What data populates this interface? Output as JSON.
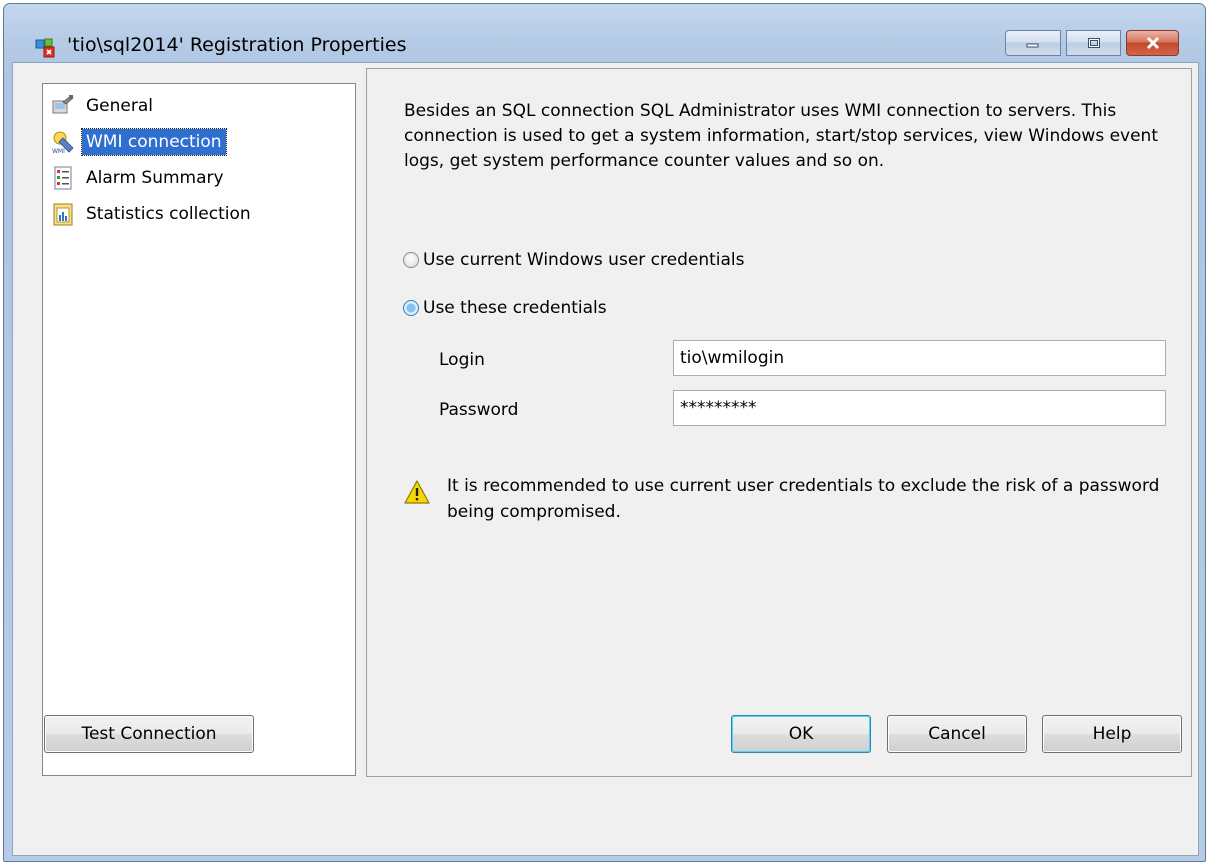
{
  "window": {
    "title": "'tio\\sql2014' Registration Properties",
    "icon": "registration-app-icon"
  },
  "nav": {
    "items": [
      {
        "label": "General",
        "icon": "general-icon",
        "selected": false
      },
      {
        "label": "WMI connection",
        "icon": "wmi-icon",
        "selected": true
      },
      {
        "label": "Alarm Summary",
        "icon": "alarm-summary-icon",
        "selected": false
      },
      {
        "label": "Statistics collection",
        "icon": "statistics-icon",
        "selected": false
      }
    ]
  },
  "content": {
    "description": "Besides an SQL connection SQL Administrator uses WMI connection to servers. This connection is used to get a system information, start/stop services, view Windows event logs, get system performance counter values and so on.",
    "radio_current": {
      "label": "Use current Windows user credentials",
      "checked": false
    },
    "radio_these": {
      "label": "Use these credentials",
      "checked": true
    },
    "login": {
      "label": "Login",
      "value": "tio\\wmilogin"
    },
    "password": {
      "label": "Password",
      "value": "*********"
    },
    "warning": "It is recommended to use current user credentials to exclude the risk of a password being compromised."
  },
  "buttons": {
    "test_connection": "Test Connection",
    "ok": "OK",
    "cancel": "Cancel",
    "help": "Help"
  },
  "colors": {
    "selection": "#2f6fd0",
    "close_button": "#c5472b",
    "warning": "#f5d800"
  }
}
